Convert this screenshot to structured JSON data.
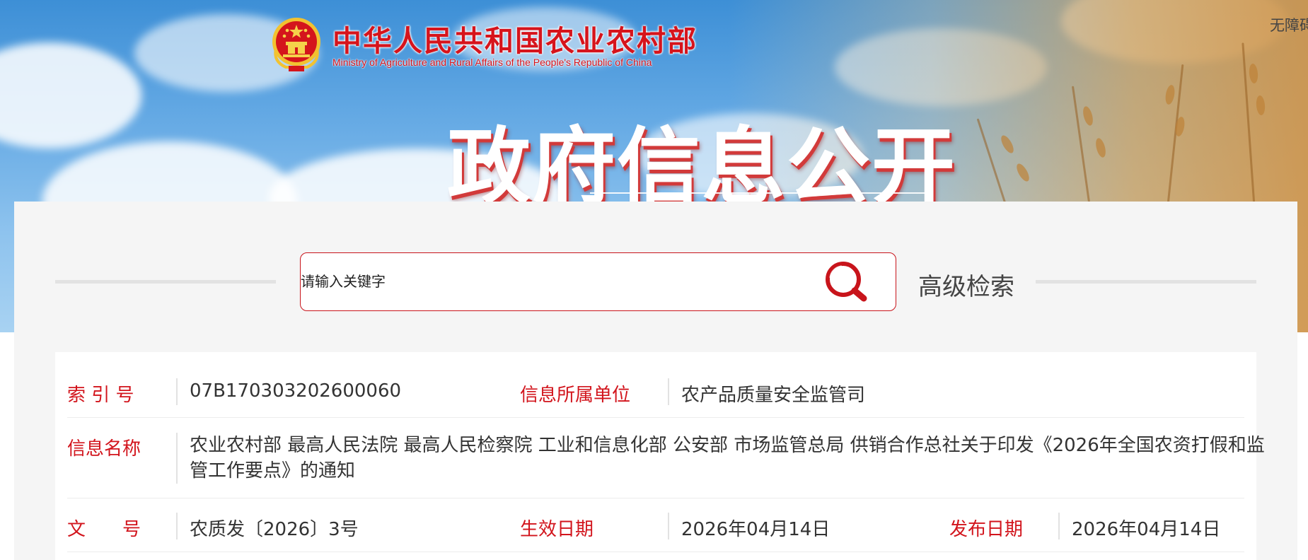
{
  "header": {
    "ministry_name_cn": "中华人民共和国农业农村部",
    "ministry_name_en": "Ministry of Agriculture and Rural Affairs of the People's Republic of China",
    "accessibility_link": "无障碍",
    "page_title": "政府信息公开",
    "emblem_icon": "national-emblem-icon"
  },
  "search": {
    "placeholder": "请输入关键字",
    "value": "",
    "search_icon": "magnifier-icon",
    "advanced_label": "高级检索"
  },
  "info": {
    "index_label": "索 引 号",
    "index_value": "07B170303202600060",
    "unit_label": "信息所属单位",
    "unit_value": "农产品质量安全监管司",
    "name_label": "信息名称",
    "name_value": "农业农村部 最高人民法院 最高人民检察院 工业和信息化部 公安部 市场监管总局 供销合作总社关于印发《2026年全国农资打假和监管工作要点》的通知",
    "doc_no_label": "文　　号",
    "doc_no_value": "农质发〔2026〕3号",
    "effective_label": "生效日期",
    "effective_value": "2026年04月14日",
    "publish_label": "发布日期",
    "publish_value": "2026年04月14日"
  },
  "colors": {
    "brand_red": "#d2141c",
    "banner_blue": "#4f9ddf",
    "panel_bg": "#f5f5f5"
  }
}
